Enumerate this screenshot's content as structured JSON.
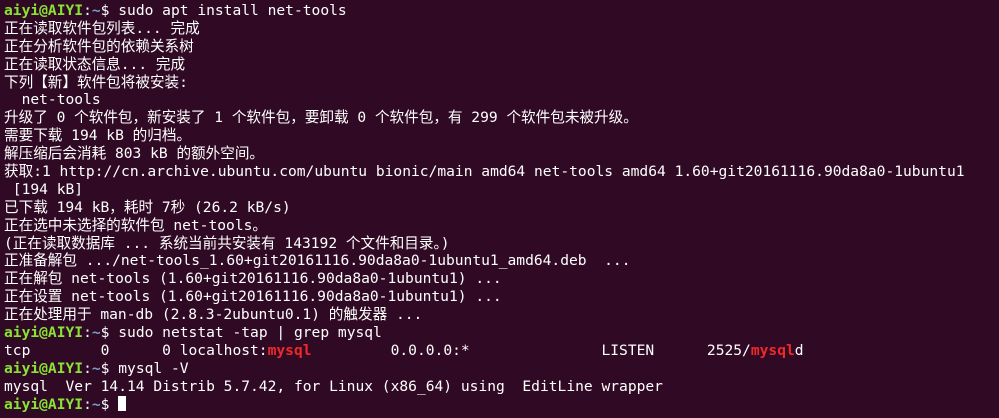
{
  "terminal": {
    "user_host": "aiyi@AIYI",
    "colon": ":",
    "path": "~",
    "prompt_symbol": "$ ",
    "lines": [
      {
        "type": "prompt",
        "command": "sudo apt install net-tools"
      },
      {
        "type": "text",
        "text": "正在读取软件包列表... 完成"
      },
      {
        "type": "text",
        "text": "正在分析软件包的依赖关系树"
      },
      {
        "type": "text",
        "text": "正在读取状态信息... 完成"
      },
      {
        "type": "text",
        "text": "下列【新】软件包将被安装:"
      },
      {
        "type": "text",
        "text": "  net-tools"
      },
      {
        "type": "text",
        "text": "升级了 0 个软件包，新安装了 1 个软件包，要卸载 0 个软件包，有 299 个软件包未被升级。"
      },
      {
        "type": "text",
        "text": "需要下载 194 kB 的归档。"
      },
      {
        "type": "text",
        "text": "解压缩后会消耗 803 kB 的额外空间。"
      },
      {
        "type": "text",
        "text": "获取:1 http://cn.archive.ubuntu.com/ubuntu bionic/main amd64 net-tools amd64 1.60+git20161116.90da8a0-1ubuntu1"
      },
      {
        "type": "text",
        "text": " [194 kB]"
      },
      {
        "type": "text",
        "text": "已下载 194 kB，耗时 7秒 (26.2 kB/s)"
      },
      {
        "type": "text",
        "text": "正在选中未选择的软件包 net-tools。"
      },
      {
        "type": "text",
        "text": "(正在读取数据库 ... 系统当前共安装有 143192 个文件和目录。)"
      },
      {
        "type": "text",
        "text": "正准备解包 .../net-tools_1.60+git20161116.90da8a0-1ubuntu1_amd64.deb  ..."
      },
      {
        "type": "text",
        "text": "正在解包 net-tools (1.60+git20161116.90da8a0-1ubuntu1) ..."
      },
      {
        "type": "text",
        "text": "正在设置 net-tools (1.60+git20161116.90da8a0-1ubuntu1) ..."
      },
      {
        "type": "text",
        "text": "正在处理用于 man-db (2.8.3-2ubuntu0.1) 的触发器 ..."
      },
      {
        "type": "prompt",
        "command": "sudo netstat -tap | grep mysql"
      },
      {
        "type": "netstat",
        "segments": [
          {
            "text": "tcp        0      0 localhost:",
            "highlight": false
          },
          {
            "text": "mysql",
            "highlight": true
          },
          {
            "text": "         0.0.0.0:*               LISTEN      2525/",
            "highlight": false
          },
          {
            "text": "mysql",
            "highlight": true
          },
          {
            "text": "d",
            "highlight": false
          }
        ]
      },
      {
        "type": "prompt",
        "command": "mysql -V"
      },
      {
        "type": "text",
        "text": "mysql  Ver 14.14 Distrib 5.7.42, for Linux (x86_64) using  EditLine wrapper"
      },
      {
        "type": "prompt",
        "command": ""
      }
    ],
    "colors": {
      "background": "#300a24",
      "text": "#ffffff",
      "user_host": "#8ae234",
      "path": "#729fcf",
      "grep_match": "#ef2929"
    }
  }
}
